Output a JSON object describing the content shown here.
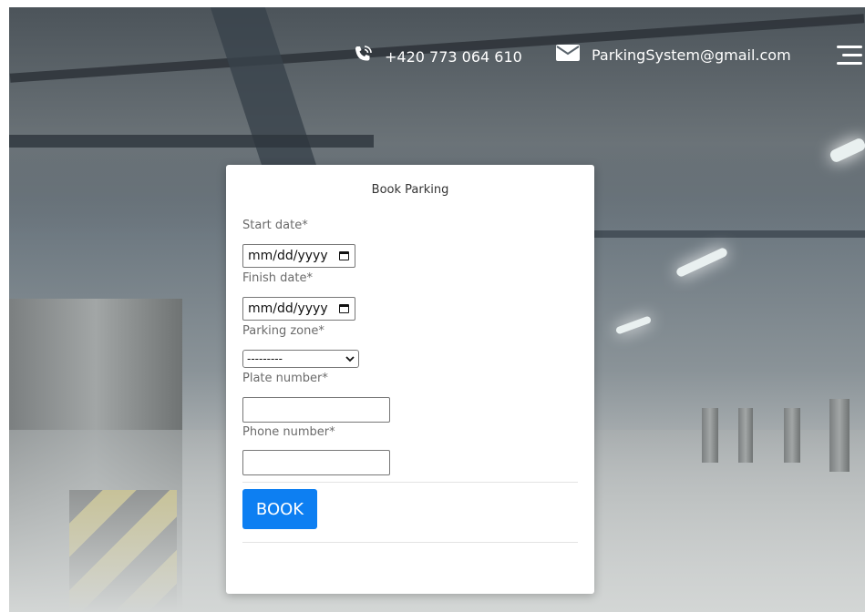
{
  "header": {
    "phone": "+420 773 064 610",
    "email": "ParkingSystem@gmail.com",
    "phone_icon": "phone-icon",
    "email_icon": "envelope-icon",
    "menu_icon": "hamburger-menu-icon"
  },
  "form": {
    "title": "Book Parking",
    "start_date": {
      "label": "Start date*",
      "value": "mm/dd/yyyy"
    },
    "finish_date": {
      "label": "Finish date*",
      "value": "mm/dd/yyyy"
    },
    "parking_zone": {
      "label": "Parking zone*",
      "selected": "---------"
    },
    "plate_number": {
      "label": "Plate number*",
      "value": ""
    },
    "phone_number": {
      "label": "Phone number*",
      "value": ""
    },
    "submit_label": "BOOK"
  },
  "colors": {
    "button": "#0d7ff2",
    "card": "#ffffff"
  }
}
